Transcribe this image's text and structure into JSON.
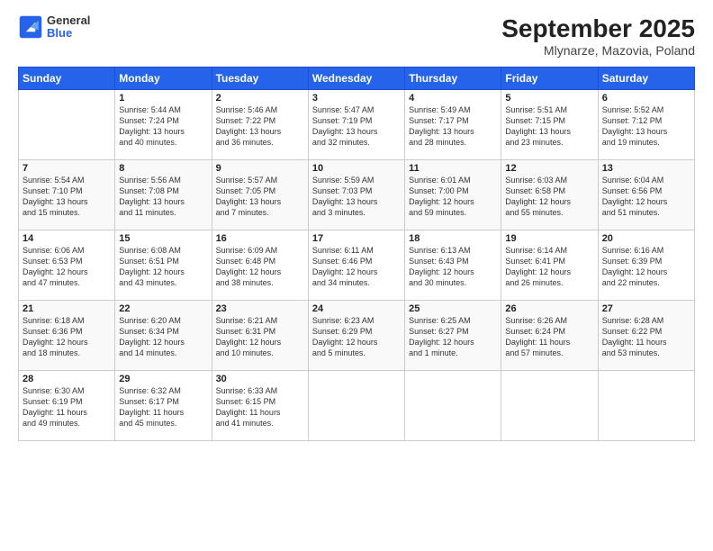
{
  "header": {
    "logo_general": "General",
    "logo_blue": "Blue",
    "month_title": "September 2025",
    "subtitle": "Mlynarze, Mazovia, Poland"
  },
  "weekdays": [
    "Sunday",
    "Monday",
    "Tuesday",
    "Wednesday",
    "Thursday",
    "Friday",
    "Saturday"
  ],
  "weeks": [
    [
      {
        "day": "",
        "info": ""
      },
      {
        "day": "1",
        "info": "Sunrise: 5:44 AM\nSunset: 7:24 PM\nDaylight: 13 hours\nand 40 minutes."
      },
      {
        "day": "2",
        "info": "Sunrise: 5:46 AM\nSunset: 7:22 PM\nDaylight: 13 hours\nand 36 minutes."
      },
      {
        "day": "3",
        "info": "Sunrise: 5:47 AM\nSunset: 7:19 PM\nDaylight: 13 hours\nand 32 minutes."
      },
      {
        "day": "4",
        "info": "Sunrise: 5:49 AM\nSunset: 7:17 PM\nDaylight: 13 hours\nand 28 minutes."
      },
      {
        "day": "5",
        "info": "Sunrise: 5:51 AM\nSunset: 7:15 PM\nDaylight: 13 hours\nand 23 minutes."
      },
      {
        "day": "6",
        "info": "Sunrise: 5:52 AM\nSunset: 7:12 PM\nDaylight: 13 hours\nand 19 minutes."
      }
    ],
    [
      {
        "day": "7",
        "info": "Sunrise: 5:54 AM\nSunset: 7:10 PM\nDaylight: 13 hours\nand 15 minutes."
      },
      {
        "day": "8",
        "info": "Sunrise: 5:56 AM\nSunset: 7:08 PM\nDaylight: 13 hours\nand 11 minutes."
      },
      {
        "day": "9",
        "info": "Sunrise: 5:57 AM\nSunset: 7:05 PM\nDaylight: 13 hours\nand 7 minutes."
      },
      {
        "day": "10",
        "info": "Sunrise: 5:59 AM\nSunset: 7:03 PM\nDaylight: 13 hours\nand 3 minutes."
      },
      {
        "day": "11",
        "info": "Sunrise: 6:01 AM\nSunset: 7:00 PM\nDaylight: 12 hours\nand 59 minutes."
      },
      {
        "day": "12",
        "info": "Sunrise: 6:03 AM\nSunset: 6:58 PM\nDaylight: 12 hours\nand 55 minutes."
      },
      {
        "day": "13",
        "info": "Sunrise: 6:04 AM\nSunset: 6:56 PM\nDaylight: 12 hours\nand 51 minutes."
      }
    ],
    [
      {
        "day": "14",
        "info": "Sunrise: 6:06 AM\nSunset: 6:53 PM\nDaylight: 12 hours\nand 47 minutes."
      },
      {
        "day": "15",
        "info": "Sunrise: 6:08 AM\nSunset: 6:51 PM\nDaylight: 12 hours\nand 43 minutes."
      },
      {
        "day": "16",
        "info": "Sunrise: 6:09 AM\nSunset: 6:48 PM\nDaylight: 12 hours\nand 38 minutes."
      },
      {
        "day": "17",
        "info": "Sunrise: 6:11 AM\nSunset: 6:46 PM\nDaylight: 12 hours\nand 34 minutes."
      },
      {
        "day": "18",
        "info": "Sunrise: 6:13 AM\nSunset: 6:43 PM\nDaylight: 12 hours\nand 30 minutes."
      },
      {
        "day": "19",
        "info": "Sunrise: 6:14 AM\nSunset: 6:41 PM\nDaylight: 12 hours\nand 26 minutes."
      },
      {
        "day": "20",
        "info": "Sunrise: 6:16 AM\nSunset: 6:39 PM\nDaylight: 12 hours\nand 22 minutes."
      }
    ],
    [
      {
        "day": "21",
        "info": "Sunrise: 6:18 AM\nSunset: 6:36 PM\nDaylight: 12 hours\nand 18 minutes."
      },
      {
        "day": "22",
        "info": "Sunrise: 6:20 AM\nSunset: 6:34 PM\nDaylight: 12 hours\nand 14 minutes."
      },
      {
        "day": "23",
        "info": "Sunrise: 6:21 AM\nSunset: 6:31 PM\nDaylight: 12 hours\nand 10 minutes."
      },
      {
        "day": "24",
        "info": "Sunrise: 6:23 AM\nSunset: 6:29 PM\nDaylight: 12 hours\nand 5 minutes."
      },
      {
        "day": "25",
        "info": "Sunrise: 6:25 AM\nSunset: 6:27 PM\nDaylight: 12 hours\nand 1 minute."
      },
      {
        "day": "26",
        "info": "Sunrise: 6:26 AM\nSunset: 6:24 PM\nDaylight: 11 hours\nand 57 minutes."
      },
      {
        "day": "27",
        "info": "Sunrise: 6:28 AM\nSunset: 6:22 PM\nDaylight: 11 hours\nand 53 minutes."
      }
    ],
    [
      {
        "day": "28",
        "info": "Sunrise: 6:30 AM\nSunset: 6:19 PM\nDaylight: 11 hours\nand 49 minutes."
      },
      {
        "day": "29",
        "info": "Sunrise: 6:32 AM\nSunset: 6:17 PM\nDaylight: 11 hours\nand 45 minutes."
      },
      {
        "day": "30",
        "info": "Sunrise: 6:33 AM\nSunset: 6:15 PM\nDaylight: 11 hours\nand 41 minutes."
      },
      {
        "day": "",
        "info": ""
      },
      {
        "day": "",
        "info": ""
      },
      {
        "day": "",
        "info": ""
      },
      {
        "day": "",
        "info": ""
      }
    ]
  ]
}
